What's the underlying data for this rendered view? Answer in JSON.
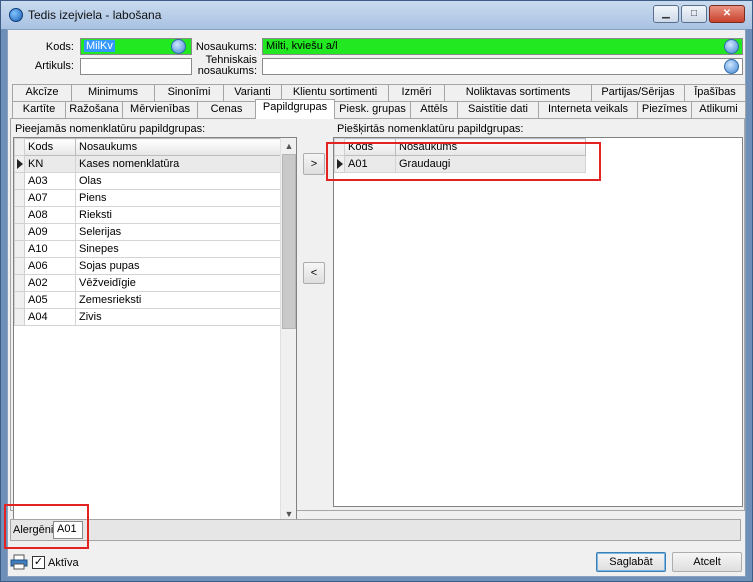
{
  "window": {
    "title": "Tedis izejviela - labošana"
  },
  "header": {
    "kods_label": "Kods:",
    "kods_value": "MilKv",
    "artikuls_label": "Artikuls:",
    "artikuls_value": "",
    "nosaukums_label": "Nosaukums:",
    "nosaukums_value": "Milti, kviešu a/l",
    "tehniskais_label_1": "Tehniskais",
    "tehniskais_label_2": "nosaukums:",
    "tehniskais_value": ""
  },
  "tabs_row1": [
    "Akcīze",
    "Minimums",
    "Sinonīmi",
    "Varianti",
    "Klientu sortimenti",
    "Izmēri",
    "Noliktavas sortiments",
    "Partijas/Sērijas",
    "Īpašības"
  ],
  "tabs_row2": [
    "Kartīte",
    "Ražošana",
    "Mērvienības",
    "Cenas",
    "Papildgrupas",
    "Piesk. grupas",
    "Attēls",
    "Saistītie dati",
    "Interneta veikals",
    "Piezīmes",
    "Atlikumi"
  ],
  "available": {
    "label": "Pieejamās nomenklatūru papildgrupas:",
    "columns": [
      "Kods",
      "Nosaukums"
    ],
    "rows": [
      [
        "KN",
        "Kases nomenklatūra"
      ],
      [
        "A03",
        "Olas"
      ],
      [
        "A07",
        "Piens"
      ],
      [
        "A08",
        "Rieksti"
      ],
      [
        "A09",
        "Selerijas"
      ],
      [
        "A10",
        "Sinepes"
      ],
      [
        "A06",
        "Sojas pupas"
      ],
      [
        "A02",
        "Vēžveidīgie"
      ],
      [
        "A05",
        "Zemesrieksti"
      ],
      [
        "A04",
        "Zivis"
      ]
    ]
  },
  "assigned": {
    "label": "Piešķirtās nomenklatūru papildgrupas:",
    "columns": [
      "Kods",
      "Nosaukums"
    ],
    "rows": [
      [
        "A01",
        "Graudaugi"
      ]
    ]
  },
  "move": {
    "add": ">",
    "remove": "<"
  },
  "alergeni": {
    "label": "Alergēni:",
    "value": "A01"
  },
  "footer": {
    "aktiva_label": "Aktīva",
    "save": "Saglabāt",
    "cancel": "Atcelt"
  }
}
